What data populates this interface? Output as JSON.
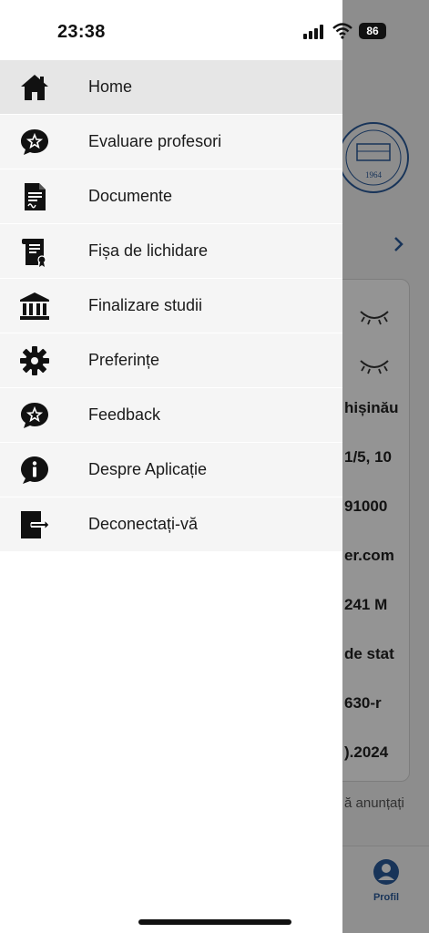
{
  "status_bar": {
    "time": "23:38",
    "battery": "86"
  },
  "menu": {
    "items": [
      {
        "label": "Home",
        "icon": "home-icon",
        "active": true
      },
      {
        "label": "Evaluare profesori",
        "icon": "star-bubble-icon"
      },
      {
        "label": "Documente",
        "icon": "document-icon"
      },
      {
        "label": "Fișa de lichidare",
        "icon": "certificate-icon"
      },
      {
        "label": "Finalizare studii",
        "icon": "institution-icon"
      },
      {
        "label": "Preferințe",
        "icon": "gear-icon"
      },
      {
        "label": "Feedback",
        "icon": "star-bubble-icon"
      },
      {
        "label": "Despre Aplicație",
        "icon": "info-bubble-icon"
      },
      {
        "label": "Deconectați-vă",
        "icon": "logout-icon"
      }
    ]
  },
  "background": {
    "seal_year": "1964",
    "card_rows": [
      "hișinău",
      "1/5, 10",
      "91000",
      "er.com",
      "241 M",
      "de stat",
      "630-r",
      ").2024"
    ],
    "note": "ă anunțați",
    "tab_profile_label": "Profil"
  },
  "colors": {
    "accent": "#2a5a9a",
    "drawer_bg": "#ffffff",
    "item_bg": "#f5f5f5",
    "active_bg": "#e6e6e6"
  }
}
